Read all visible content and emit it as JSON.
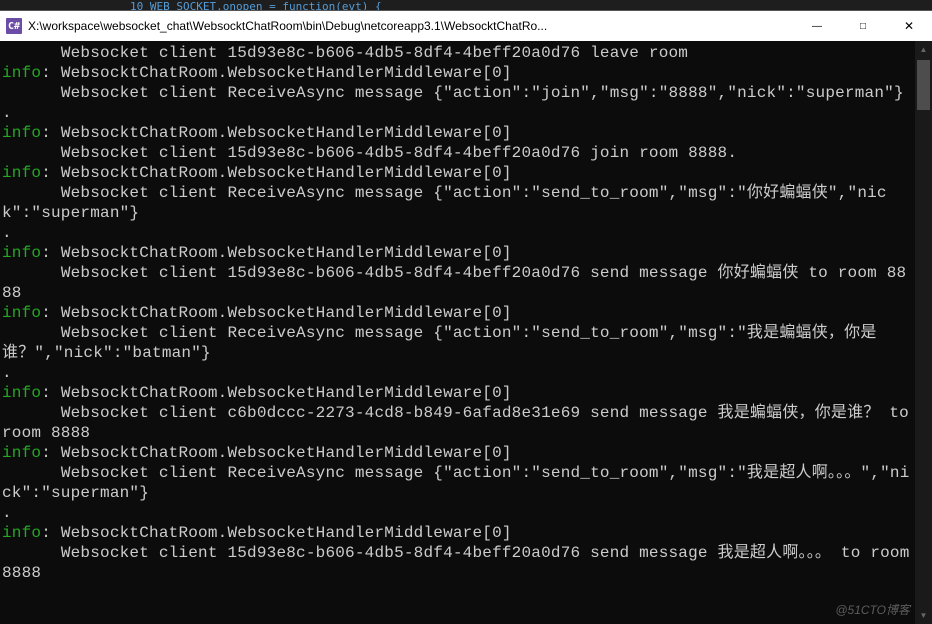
{
  "window": {
    "title": "X:\\workspace\\websocket_chat\\WebsocktChatRoom\\bin\\Debug\\netcoreapp3.1\\WebsocktChatRo...",
    "icon_label": "C#",
    "minimize": "—",
    "maximize": "□",
    "close": "✕"
  },
  "editor_behind": "   10       WEB_SOCKET.onopen = function(evt) {",
  "console": {
    "info_label": "info",
    "lines": {
      "l0": "      Websocket client 15d93e8c-b606-4db5-8df4-4beff20a0d76 leave room",
      "l1b": ": WebsocktChatRoom.WebsocketHandlerMiddleware[0]",
      "l2": "      Websocket client ReceiveAsync message {\"action\":\"join\",\"msg\":\"8888\",\"nick\":\"superman\"}",
      "dot": ".",
      "l3b": ": WebsocktChatRoom.WebsocketHandlerMiddleware[0]",
      "l4": "      Websocket client 15d93e8c-b606-4db5-8df4-4beff20a0d76 join room 8888.",
      "l5b": ": WebsocktChatRoom.WebsocketHandlerMiddleware[0]",
      "l6": "      Websocket client ReceiveAsync message {\"action\":\"send_to_room\",\"msg\":\"你好蝙蝠侠\",\"nick\":\"superman\"}",
      "l7b": ": WebsocktChatRoom.WebsocketHandlerMiddleware[0]",
      "l8": "      Websocket client 15d93e8c-b606-4db5-8df4-4beff20a0d76 send message 你好蝙蝠侠 to room 8888",
      "l9b": ": WebsocktChatRoom.WebsocketHandlerMiddleware[0]",
      "l10": "      Websocket client ReceiveAsync message {\"action\":\"send_to_room\",\"msg\":\"我是蝙蝠侠，你是谁？\",\"nick\":\"batman\"}",
      "l11b": ": WebsocktChatRoom.WebsocketHandlerMiddleware[0]",
      "l12": "      Websocket client c6b0dccc-2273-4cd8-b849-6afad8e31e69 send message 我是蝙蝠侠，你是谁？ to room 8888",
      "l13b": ": WebsocktChatRoom.WebsocketHandlerMiddleware[0]",
      "l14": "      Websocket client ReceiveAsync message {\"action\":\"send_to_room\",\"msg\":\"我是超人啊。。。\",\"nick\":\"superman\"}",
      "l15b": ": WebsocktChatRoom.WebsocketHandlerMiddleware[0]",
      "l16": "      Websocket client 15d93e8c-b606-4db5-8df4-4beff20a0d76 send message 我是超人啊。。。 to room 8888"
    }
  },
  "watermark": "@51CTO博客"
}
